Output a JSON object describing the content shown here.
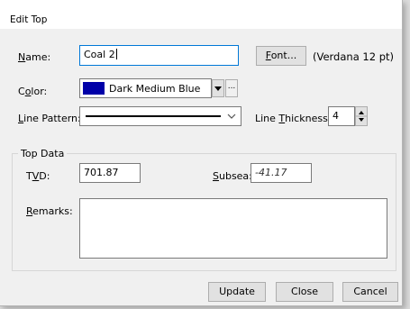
{
  "dialog": {
    "title": "Edit Top"
  },
  "name": {
    "label_pre": "",
    "label_accel": "N",
    "label_post": "ame:",
    "value": "Coal 2"
  },
  "font": {
    "button_label_pre": "",
    "button_label_accel": "F",
    "button_label_post": "ont...",
    "description": "(Verdana 12 pt)"
  },
  "color": {
    "label_pre": "C",
    "label_accel": "o",
    "label_post": "lor:",
    "selected": "Dark Medium Blue",
    "swatch_hex": "#0000a8",
    "more_label": "..."
  },
  "line_pattern": {
    "label_pre": "",
    "label_accel": "L",
    "label_post": "ine Pattern:"
  },
  "line_thickness": {
    "label_pre": "Line ",
    "label_accel": "T",
    "label_post": "hickness:",
    "value": "4"
  },
  "top_data": {
    "group_label": "Top Data",
    "tvd_label_pre": "T",
    "tvd_label_accel": "V",
    "tvd_label_post": "D:",
    "tvd_value": "701.87",
    "subsea_label_pre": "",
    "subsea_label_accel": "S",
    "subsea_label_post": "ubsea:",
    "subsea_value": "-41.17",
    "remarks_label_pre": "",
    "remarks_label_accel": "R",
    "remarks_label_post": "emarks:",
    "remarks_value": ""
  },
  "buttons": {
    "update": "Update",
    "close": "Close",
    "cancel": "Cancel"
  }
}
